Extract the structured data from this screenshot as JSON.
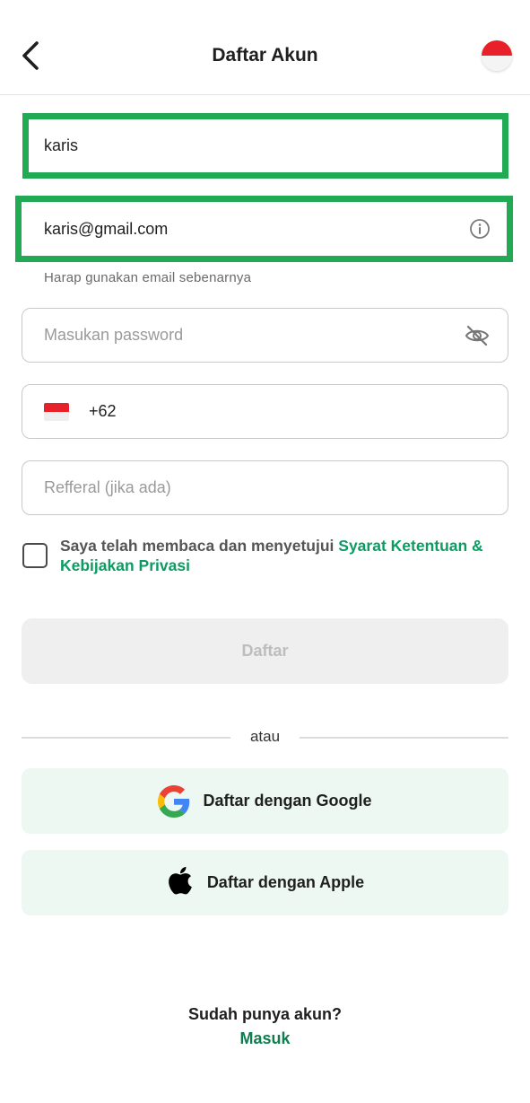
{
  "header": {
    "title": "Daftar Akun",
    "back_icon": "chevron-left-icon",
    "language_flag": "indonesia-flag-icon"
  },
  "form": {
    "name": {
      "value": "karis",
      "placeholder": ""
    },
    "email": {
      "value": "karis@gmail.com",
      "placeholder": "",
      "helper": "Harap gunakan email sebenarnya",
      "icon": "info-icon"
    },
    "password": {
      "value": "",
      "placeholder": "Masukan password",
      "icon": "eye-off-icon"
    },
    "phone": {
      "value": "+62",
      "placeholder": "",
      "flag": "indonesia-flag-icon"
    },
    "referral": {
      "value": "",
      "placeholder": "Refferal (jika ada)"
    },
    "terms": {
      "checked": false,
      "text": "Saya telah membaca dan menyetujui ",
      "link": "Syarat Ketentuan & Kebijakan Privasi"
    },
    "submit_label": "Daftar"
  },
  "divider_text": "atau",
  "social": {
    "google_label": "Daftar dengan Google",
    "apple_label": "Daftar dengan Apple"
  },
  "footer": {
    "question": "Sudah punya akun?",
    "login_link": "Masuk"
  },
  "colors": {
    "accent": "#0e9a63",
    "highlight_border": "#21a953",
    "social_bg": "#edf8f3",
    "submit_disabled_bg": "#efefef"
  }
}
